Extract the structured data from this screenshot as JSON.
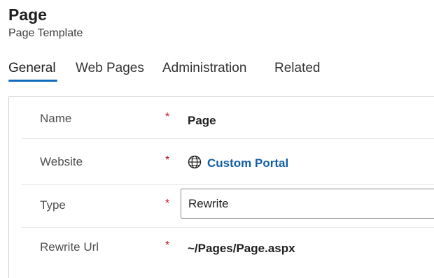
{
  "header": {
    "title": "Page",
    "subtitle": "Page Template"
  },
  "tabs": [
    {
      "label": "General",
      "active": true
    },
    {
      "label": "Web Pages",
      "active": false
    },
    {
      "label": "Administration",
      "active": false
    },
    {
      "label": "Related",
      "active": false
    }
  ],
  "form": {
    "required_marker": "*",
    "name": {
      "label": "Name",
      "value": "Page"
    },
    "website": {
      "label": "Website",
      "value": "Custom Portal",
      "icon": "globe-icon"
    },
    "type": {
      "label": "Type",
      "value": "Rewrite"
    },
    "rewrite_url": {
      "label": "Rewrite Url",
      "value": "~/Pages/Page.aspx"
    }
  },
  "colors": {
    "accent": "#0f6cbd",
    "link": "#115ea3",
    "required": "#c50f1f"
  }
}
